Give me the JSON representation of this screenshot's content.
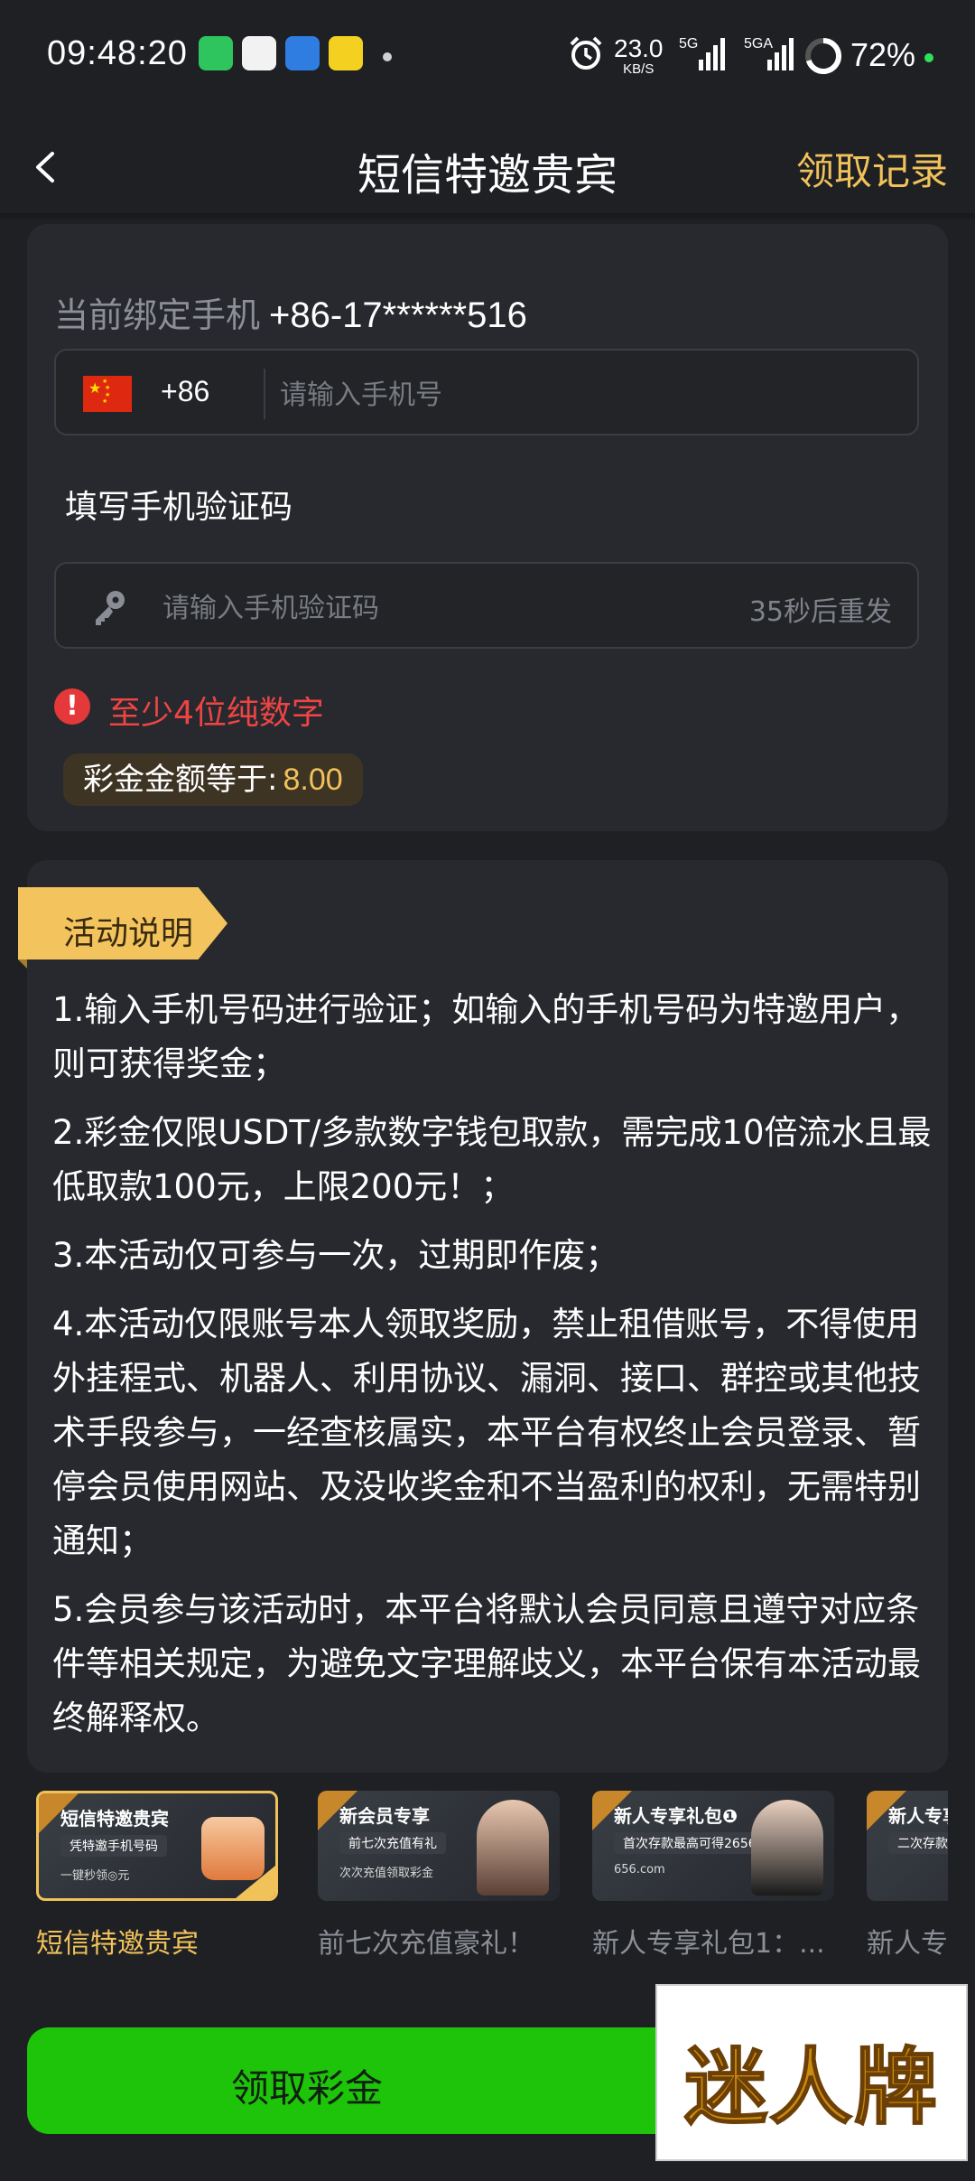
{
  "status_bar": {
    "time": "09:48:20",
    "net_speed": "23.0",
    "net_speed_unit": "KB/S",
    "sig1": "5G",
    "sig2": "5GA",
    "battery": "72%",
    "apps": [
      "wechat-icon",
      "qq-icon",
      "qq-alt-icon",
      "game-app-icon"
    ]
  },
  "header": {
    "title": "短信特邀贵宾",
    "record_link": "领取记录"
  },
  "form": {
    "bound_label": "当前绑定手机",
    "bound_value": "+86-17******516",
    "country_code": "+86",
    "phone_placeholder": "请输入手机号",
    "code_section_label": "填写手机验证码",
    "code_placeholder": "请输入手机验证码",
    "resend_text": "35秒后重发",
    "error_icon": "!",
    "error_text": "至少4位纯数字",
    "bonus_label": "彩金金额等于:",
    "bonus_value": "8.00"
  },
  "activity": {
    "tag": "活动说明",
    "rules": [
      "1.输入手机号码进行验证；如输入的手机号码为特邀用户，则可获得奖金；",
      "2.彩金仅限USDT/多款数字钱包取款，需完成10倍流水且最低取款100元，上限200元！；",
      "3.本活动仅可参与一次，过期即作废；",
      "4.本活动仅限账号本人领取奖励，禁止租借账号，不得使用外挂程式、机器人、利用协议、漏洞、接口、群控或其他技术手段参与，一经查核属实，本平台有权终止会员登录、暂停会员使用网站、及没收奖金和不当盈利的权利，无需特别通知；",
      "5.会员参与该活动时，本平台将默认会员同意且遵守对应条件等相关规定，为避免文字理解歧义，本平台保有本活动最终解释权。"
    ]
  },
  "promos": [
    {
      "title": "短信特邀贵宾",
      "sub": "凭特邀手机号码",
      "sub2": "一键秒领◎元",
      "label": "短信特邀贵宾",
      "active": true
    },
    {
      "title": "新会员专享",
      "sub": "前七次充值有礼",
      "sub2": "次次充值领取彩金",
      "label": "前七次充值豪礼！",
      "active": false
    },
    {
      "title": "新人专享礼包❶",
      "sub": "首次存款最高可得2656元",
      "sub2": "656.com",
      "label": "新人专享礼包1：...",
      "active": false
    },
    {
      "title": "新人专享",
      "sub": "二次存款再",
      "sub2": "",
      "label": "新人专",
      "active": false
    }
  ],
  "claim_button": "领取彩金",
  "watermark": "迷人牌",
  "colors": {
    "background": "#1e2024",
    "card": "#27292e",
    "accent_gold": "#f1c15a",
    "error_red": "#ee4444",
    "button_green": "#1ec40a"
  }
}
